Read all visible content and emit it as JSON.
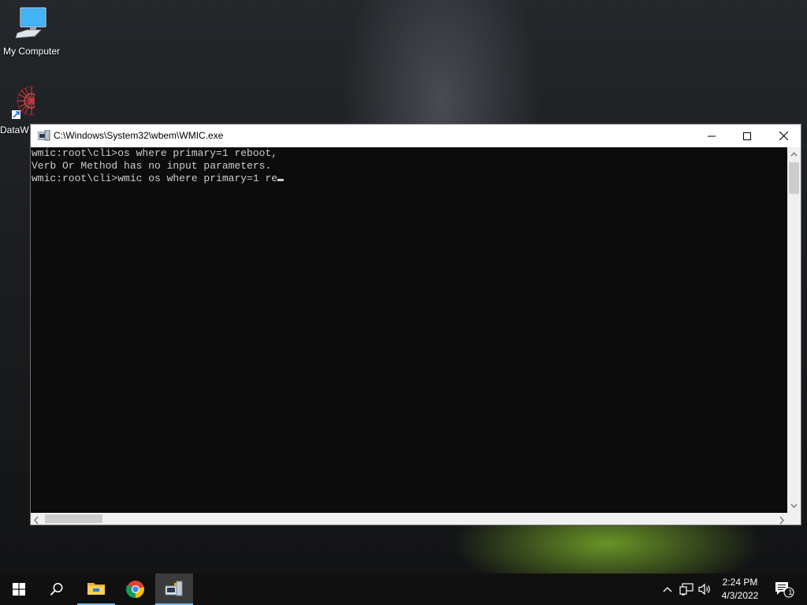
{
  "desktop": {
    "icons": [
      {
        "label": "My Computer",
        "icon": "computer-icon"
      },
      {
        "label": "DataW",
        "icon": "datawarehouse-shortcut-icon"
      }
    ]
  },
  "window": {
    "title": "C:\\Windows\\System32\\wbem\\WMIC.exe",
    "icon": "wmic-app-icon",
    "controls": [
      "minimize-icon",
      "maximize-icon",
      "close-icon"
    ]
  },
  "console": {
    "background": "#0c0c0c",
    "text_color": "#cccccc",
    "lines": [
      "wmic:root\\cli>os where primary=1 reboot,",
      "Verb Or Method has no input parameters.",
      "wmic:root\\cli>wmic os where primary=1 re"
    ]
  },
  "taskbar": {
    "buttons": [
      "windows-start-icon",
      "search-icon",
      "file-explorer-icon",
      "chrome-icon",
      "wmic-taskbar-icon"
    ],
    "tray": {
      "icons": [
        "chevron-up-icon",
        "network-icon",
        "volume-icon"
      ],
      "time": "2:24 PM",
      "date": "4/3/2022",
      "notification_count": "1"
    },
    "accent": "#76b9ed"
  }
}
